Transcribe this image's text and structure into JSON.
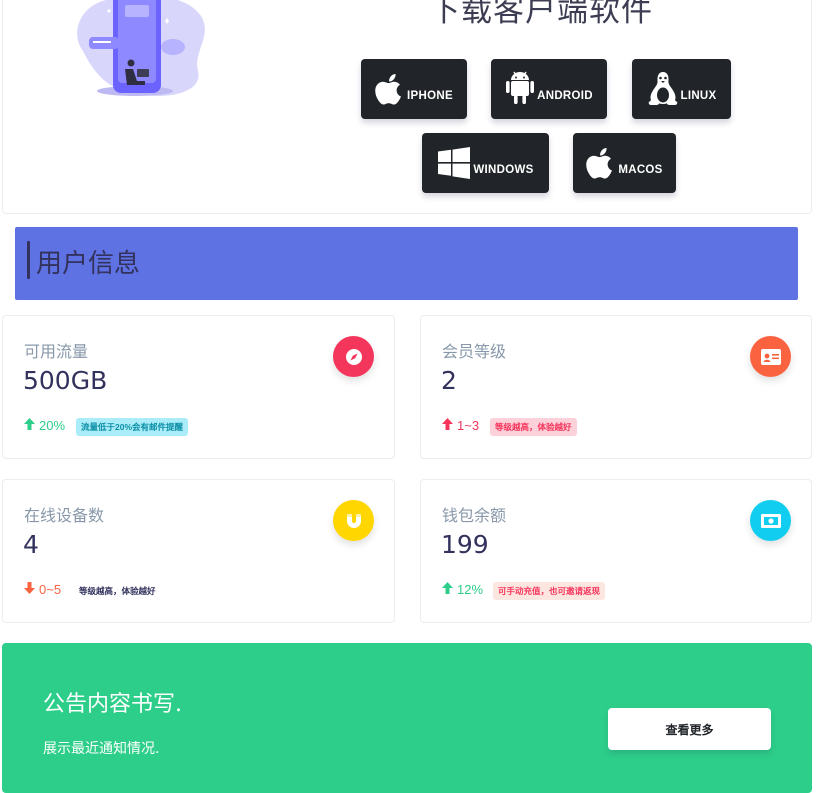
{
  "download": {
    "title": "下载客户端软件",
    "buttons": [
      {
        "label": "IPHONE",
        "icon": "apple-icon"
      },
      {
        "label": "ANDROID",
        "icon": "android-icon"
      },
      {
        "label": "LINUX",
        "icon": "linux-tux-icon"
      },
      {
        "label": "WINDOWS",
        "icon": "windows-icon"
      },
      {
        "label": "MACOS",
        "icon": "apple-icon"
      }
    ]
  },
  "section": {
    "title": "用户信息"
  },
  "stats": [
    {
      "title": "可用流量",
      "value": "500GB",
      "trend": "20%",
      "direction": "up",
      "trend_color": "#2dce89",
      "note": "流量低于20%会有邮件提醒",
      "note_bg": "#aaedf9",
      "note_color": "#0b8ea5",
      "icon": "compass-icon",
      "icon_bg": "#f5365c"
    },
    {
      "title": "会员等级",
      "value": "2",
      "trend": "1~3",
      "direction": "up",
      "trend_color": "#f5365c",
      "note": "等级越高，体验越好",
      "note_bg": "#fdd1da",
      "note_color": "#f5365c",
      "icon": "id-card-icon",
      "icon_bg": "#fb6340"
    },
    {
      "title": "在线设备数",
      "value": "4",
      "trend": "0~5",
      "direction": "down",
      "trend_color": "#fb6340",
      "note": "等级越高，体验越好",
      "note_bg": "transparent",
      "note_color": "#32325d",
      "icon": "magnet-icon",
      "icon_bg": "#ffd600"
    },
    {
      "title": "钱包余额",
      "value": "199",
      "trend": "12%",
      "direction": "up",
      "trend_color": "#2dce89",
      "note": "可手动充值，也可邀请返现",
      "note_bg": "#fee6e0",
      "note_color": "#f5365c",
      "icon": "money-bill-icon",
      "icon_bg": "#11cdef"
    }
  ],
  "notice": {
    "title": "公告内容书写.",
    "subtitle": "展示最近通知情况.",
    "button": "查看更多"
  }
}
